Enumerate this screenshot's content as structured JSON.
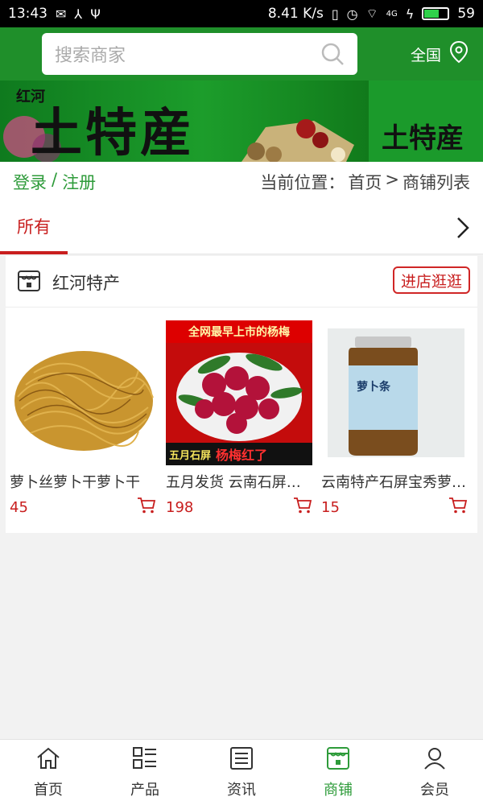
{
  "status_bar": {
    "time": "13:43",
    "speed": "8.41 K/s",
    "network": "4G",
    "battery": "59",
    "battery_level": 0.59
  },
  "search": {
    "placeholder": "搜索商家"
  },
  "region": {
    "label": "全国"
  },
  "banner": {
    "small_text": "红河",
    "title": "土特産",
    "side_title": "土特産"
  },
  "auth": {
    "login": "登录",
    "separator": "/",
    "register": "注册"
  },
  "breadcrumb": {
    "prefix": "当前位置：",
    "home": "首页",
    "arrow": ">",
    "current": "商铺列表"
  },
  "tabs": {
    "active": "所有"
  },
  "shop": {
    "name": "红河特产",
    "enter_label": "进店逛逛",
    "products": [
      {
        "name": "萝卜丝萝卜干萝卜干",
        "price": "45"
      },
      {
        "name": "五月发货 云南石屏杨梅",
        "price": "198",
        "image_top_text": "全网最早上市的杨梅",
        "image_bottom_left": "五月石屏",
        "image_bottom_right": "杨梅红了"
      },
      {
        "name": "云南特产石屏宝秀萝卜条",
        "price": "15",
        "jar_label": "萝卜条"
      }
    ]
  },
  "bottom_nav": [
    {
      "label": "首页",
      "icon": "home-icon"
    },
    {
      "label": "产品",
      "icon": "grid-list-icon"
    },
    {
      "label": "资讯",
      "icon": "news-icon"
    },
    {
      "label": "商铺",
      "icon": "store-icon",
      "active": true
    },
    {
      "label": "会员",
      "icon": "user-icon"
    }
  ],
  "colors": {
    "brand_green": "#1f8f2a",
    "accent_red": "#c81e1e",
    "link_green": "#2e9b3a"
  }
}
